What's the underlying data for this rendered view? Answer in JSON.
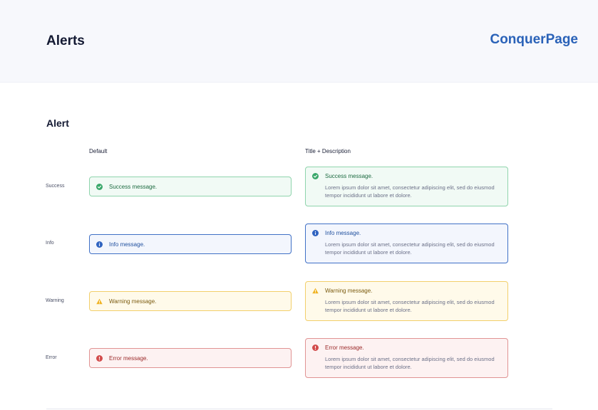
{
  "header": {
    "title": "Alerts",
    "brand": "ConquerPage"
  },
  "section": {
    "title": "Alert"
  },
  "columns": {
    "default": "Default",
    "full": "Title + Description"
  },
  "rows": [
    {
      "label": "Success",
      "icon": "check-circle-icon",
      "color": "#3aa86b",
      "message": "Success message."
    },
    {
      "label": "Info",
      "icon": "info-circle-icon",
      "color": "#2f63c0",
      "message": "Info message."
    },
    {
      "label": "Warning",
      "icon": "warning-triangle-icon",
      "color": "#f0b323",
      "message": "Warning message."
    },
    {
      "label": "Error",
      "icon": "error-circle-icon",
      "color": "#d24b4b",
      "message": "Error message."
    }
  ],
  "description": "Lorem ipsum dolor sit amet, consectetur adipiscing elit, sed do eiusmod tempor incididunt ut labore et dolore."
}
